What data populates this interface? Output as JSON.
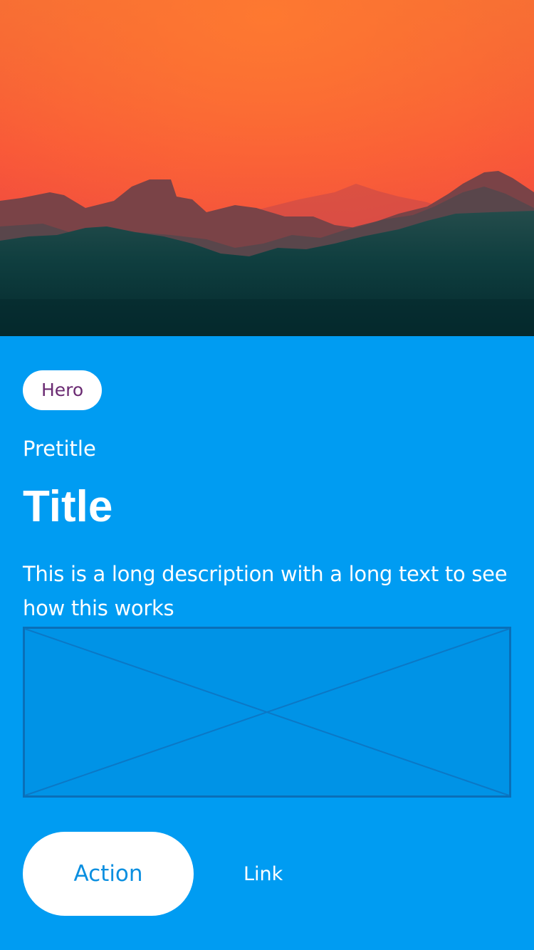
{
  "hero": {
    "image_name": "mountain-sunset-image"
  },
  "card": {
    "tag_label": "Hero",
    "pretitle": "Pretitle",
    "title": "Title",
    "description": "This is a long description with a long text to see how this works",
    "placeholder_name": "image-placeholder",
    "action_label": "Action",
    "link_label": "Link"
  },
  "colors": {
    "background": "#009cf2",
    "tag_text": "#6a2a72",
    "button_background": "#ffffff",
    "button_text": "#0a8fe0",
    "text": "#ffffff"
  }
}
